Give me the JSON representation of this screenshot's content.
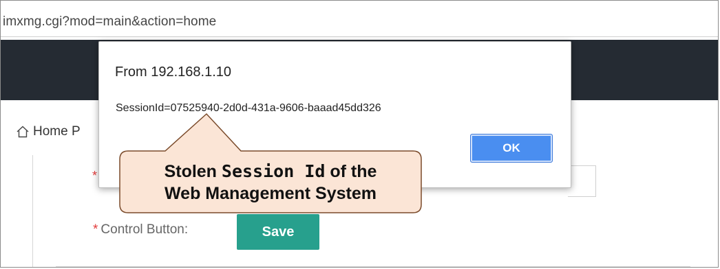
{
  "browser": {
    "address_text": "imxmg.cgi?mod=main&action=home"
  },
  "page": {
    "breadcrumb_label": "Home P",
    "field1_required_mark": "*",
    "control_button_label": "Control Button:",
    "required_mark": "*",
    "save_label": "Save"
  },
  "dialog": {
    "title": "From 192.168.1.10",
    "message": "SessionId=07525940-2d0d-431a-9606-baaad45dd326",
    "ok_label": "OK"
  },
  "callout": {
    "line1_part1": "Stolen ",
    "line1_part2": "Session Id",
    "line1_part3": " of the",
    "line2": "Web Management System"
  },
  "colors": {
    "header_dark": "#252b33",
    "save_button": "#27a08d",
    "ok_button": "#4a8ef0",
    "callout_fill": "#fbe5d6",
    "callout_border": "#7a4a2a",
    "required": "#e23b3b"
  }
}
